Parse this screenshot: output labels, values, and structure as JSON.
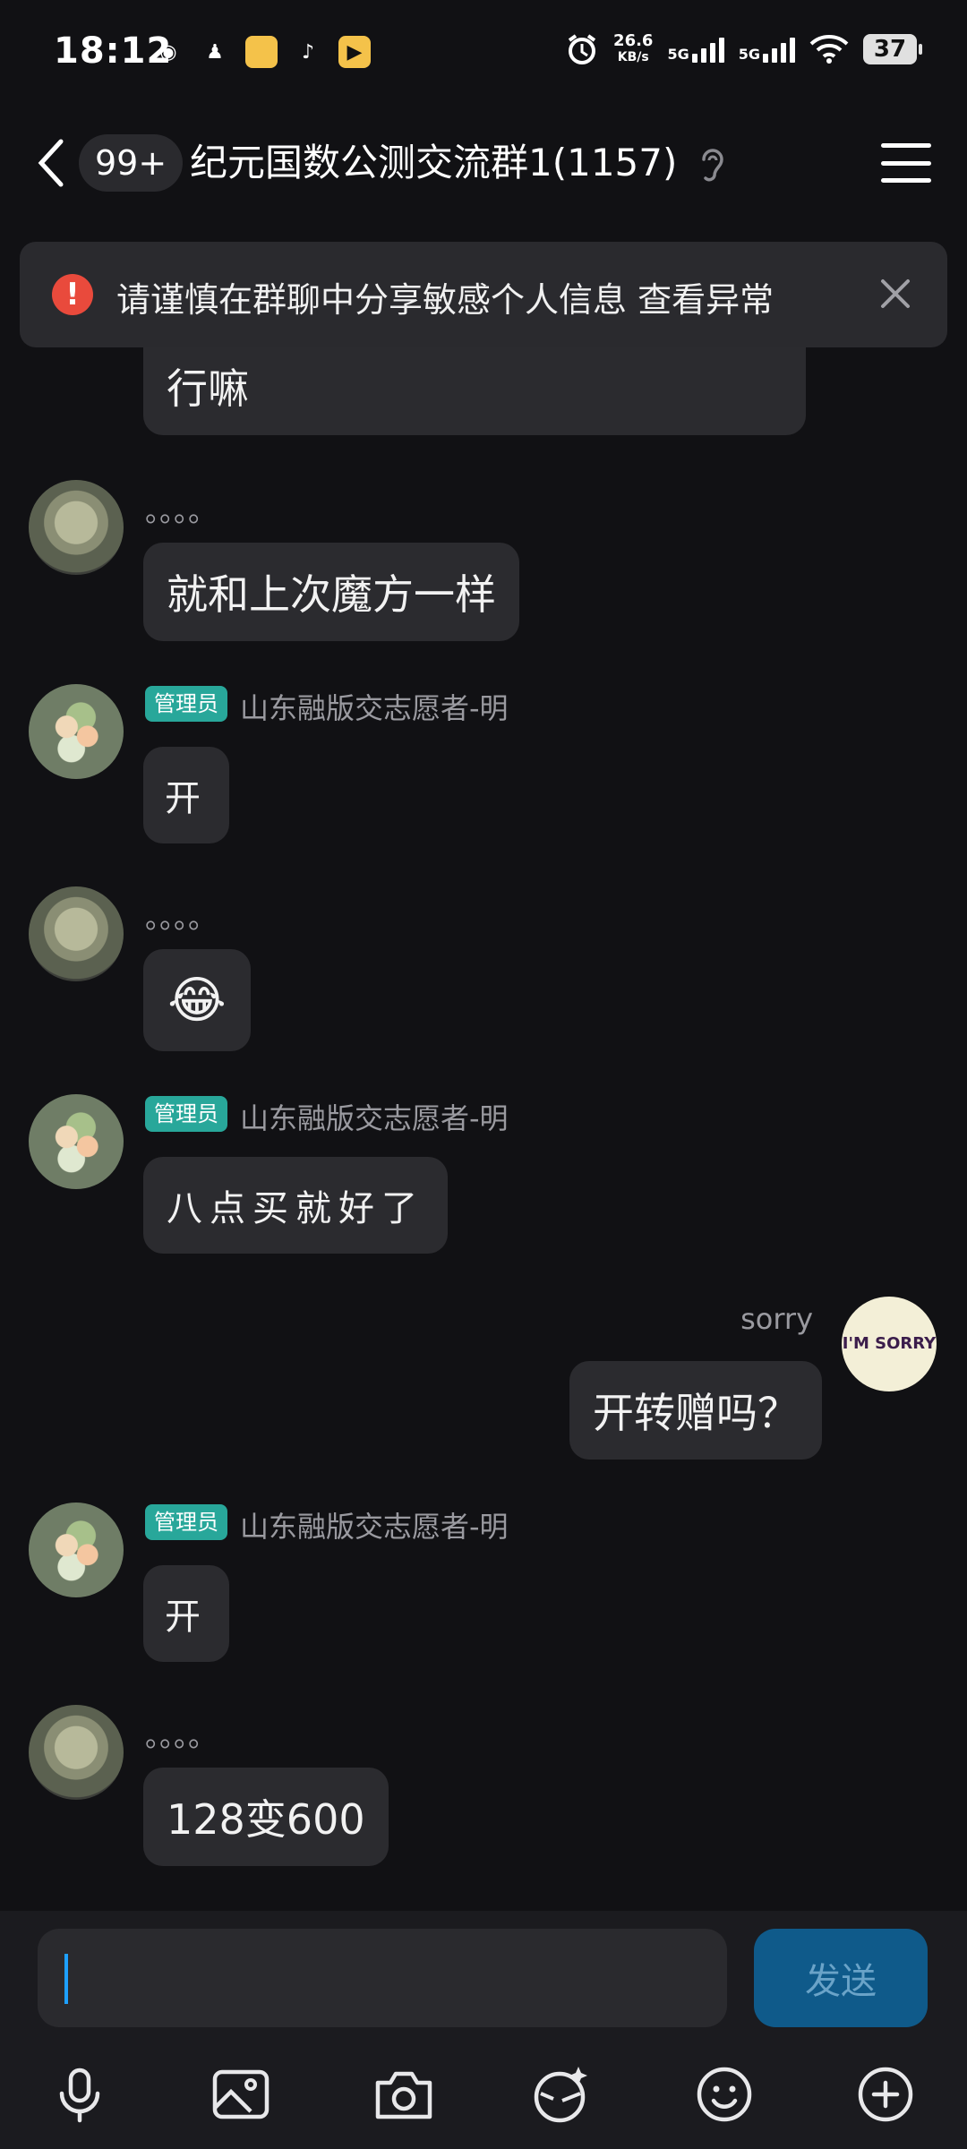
{
  "status": {
    "time": "18:12",
    "net_speed_value": "26.6",
    "net_speed_unit": "KB/s",
    "net1": "5G",
    "net2": "5G",
    "battery": "37"
  },
  "header": {
    "unread": "99+",
    "title": "纪元国数公测交流群1(1157)"
  },
  "warning": {
    "text": "请谨慎在群聊中分享敏感个人信息 查看异常"
  },
  "messages": [
    {
      "text": "行嘛"
    },
    {
      "sender": "。。。。",
      "text": "就和上次魔方一样"
    },
    {
      "badge": "管理员",
      "sender": "山东融版交志愿者-明",
      "text": "开"
    },
    {
      "sender": "。。。。",
      "text": "😂"
    },
    {
      "badge": "管理员",
      "sender": "山东融版交志愿者-明",
      "text": "八点买就好了"
    },
    {
      "sender": "sorry",
      "text": "开转赠吗？",
      "avatar_text": "I'M SORRY"
    },
    {
      "badge": "管理员",
      "sender": "山东融版交志愿者-明",
      "text": "开"
    },
    {
      "sender": "。。。。",
      "text": "128变600"
    }
  ],
  "composer": {
    "send_label": "发送"
  },
  "icons": [
    "back-chevron-icon",
    "ear-icon",
    "menu-icon",
    "warning-icon",
    "close-icon",
    "microphone-icon",
    "image-icon",
    "camera-icon",
    "sticker-icon",
    "emoji-icon",
    "plus-icon"
  ]
}
